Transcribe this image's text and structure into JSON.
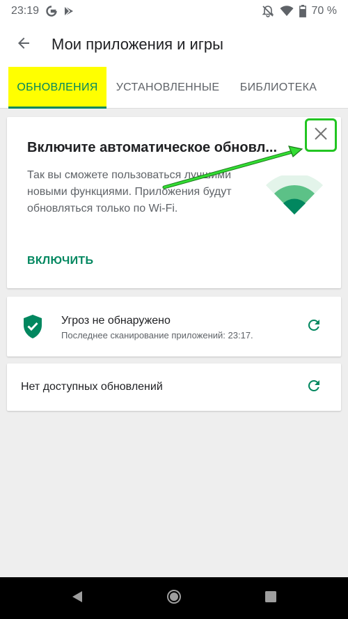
{
  "status_bar": {
    "time": "23:19",
    "battery": "70 %"
  },
  "app_bar": {
    "title": "Мои приложения и игры"
  },
  "tabs": [
    {
      "label": "ОБНОВЛЕНИЯ",
      "active": true
    },
    {
      "label": "УСТАНОВЛЕННЫЕ",
      "active": false
    },
    {
      "label": "БИБЛИОТЕКА",
      "active": false
    }
  ],
  "auto_update_card": {
    "title": "Включите автоматическое обновл...",
    "body": "Так вы сможете пользоваться лучшими новыми функциями. Приложения будут обновляться только по Wi-Fi.",
    "enable_label": "ВКЛЮЧИТЬ"
  },
  "protect_card": {
    "title": "Угроз не обнаружено",
    "subtitle": "Последнее сканирование приложений: 23:17."
  },
  "updates_card": {
    "text": "Нет доступных обновлений"
  },
  "icons": {
    "status_left": [
      "google-g-icon",
      "play-store-icon"
    ],
    "status_right": [
      "notifications-off-icon",
      "wifi-icon",
      "battery-icon"
    ],
    "back": "back-arrow-icon",
    "close": "close-icon",
    "illustration": "wifi-illustration-icon",
    "shield": "shield-check-icon",
    "refresh": "refresh-icon",
    "nav": [
      "nav-back-icon",
      "nav-home-icon",
      "nav-recents-icon"
    ]
  },
  "colors": {
    "accent": "#01875f",
    "tab_highlight": "#ffff00",
    "annotation": "#22c522"
  }
}
